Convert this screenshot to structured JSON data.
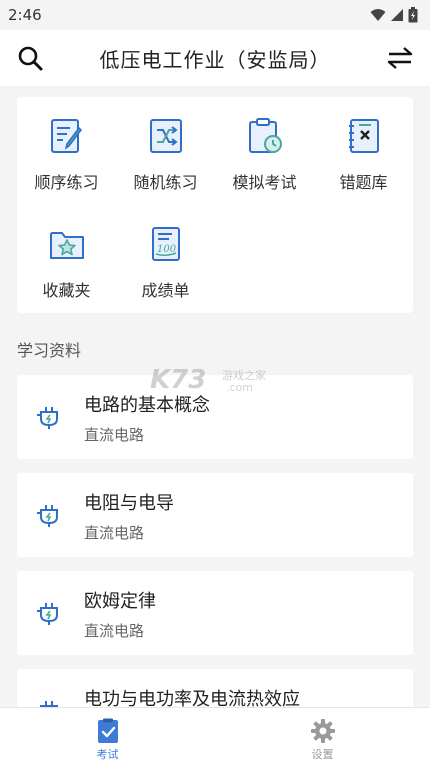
{
  "status_bar": {
    "time": "2:46"
  },
  "app_bar": {
    "title": "低压电工作业（安监局）"
  },
  "menu": [
    {
      "label": "顺序练习",
      "icon": "edit-note-icon"
    },
    {
      "label": "随机练习",
      "icon": "shuffle-icon"
    },
    {
      "label": "模拟考试",
      "icon": "clipboard-clock-icon"
    },
    {
      "label": "错题库",
      "icon": "wrong-notebook-icon"
    },
    {
      "label": "收藏夹",
      "icon": "star-folder-icon"
    },
    {
      "label": "成绩单",
      "icon": "score-sheet-icon"
    }
  ],
  "section_title": "学习资料",
  "watermark": {
    "main": "K73",
    "sub": "游戏之家",
    "sub2": ".com"
  },
  "materials": [
    {
      "title": "电路的基本概念",
      "subtitle": "直流电路"
    },
    {
      "title": "电阻与电导",
      "subtitle": "直流电路"
    },
    {
      "title": "欧姆定律",
      "subtitle": "直流电路"
    },
    {
      "title": "电功与电功率及电流热效应",
      "subtitle": ""
    }
  ],
  "bottom_nav": [
    {
      "label": "考试",
      "active": true,
      "icon": "exam-icon"
    },
    {
      "label": "设置",
      "active": false,
      "icon": "gear-icon"
    }
  ],
  "colors": {
    "accent": "#3e7bd6",
    "icon_blue": "#2f6fc9",
    "icon_teal": "#4aa7a0"
  }
}
